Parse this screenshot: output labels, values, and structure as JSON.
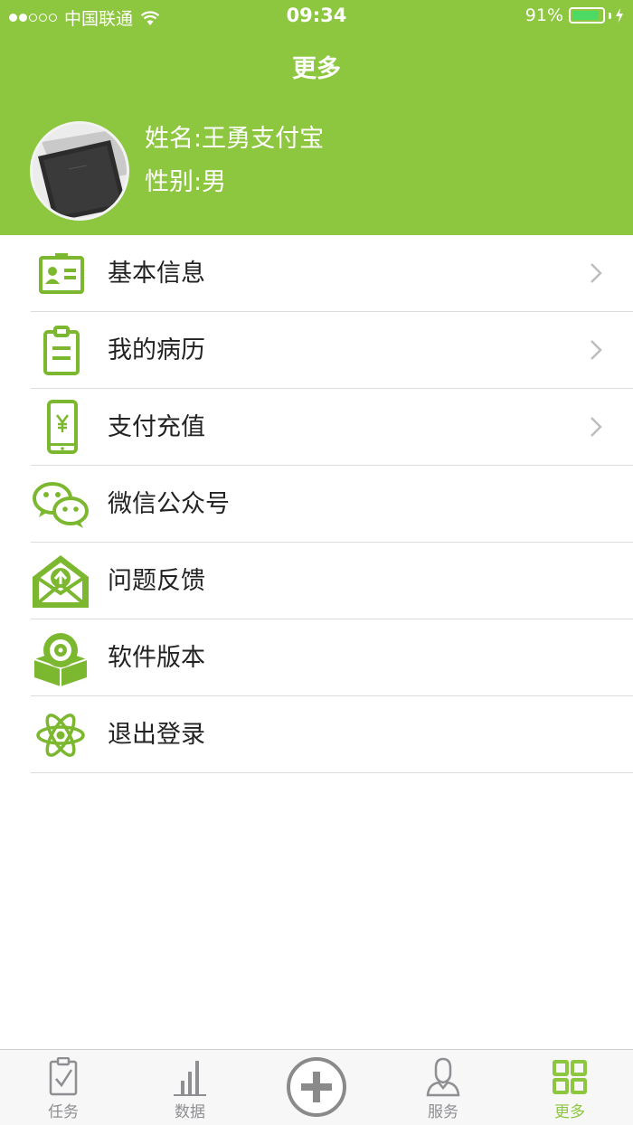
{
  "status_bar": {
    "carrier": "中国联通",
    "time": "09:34",
    "battery_percent": "91%",
    "battery_level": 0.91
  },
  "nav": {
    "title": "更多"
  },
  "profile": {
    "name_line": "姓名:王勇支付宝",
    "gender_line": "性别:男"
  },
  "menu": {
    "items": [
      {
        "label": "基本信息",
        "icon": "id-card-icon",
        "has_chevron": true
      },
      {
        "label": "我的病历",
        "icon": "clipboard-icon",
        "has_chevron": true
      },
      {
        "label": "支付充值",
        "icon": "phone-yuan-icon",
        "has_chevron": true
      },
      {
        "label": "微信公众号",
        "icon": "wechat-icon",
        "has_chevron": false
      },
      {
        "label": "问题反馈",
        "icon": "mail-upload-icon",
        "has_chevron": false
      },
      {
        "label": "软件版本",
        "icon": "software-box-icon",
        "has_chevron": false
      },
      {
        "label": "退出登录",
        "icon": "atom-icon",
        "has_chevron": false
      }
    ]
  },
  "tabbar": {
    "tabs": [
      {
        "label": "任务",
        "icon": "task-clipboard-icon"
      },
      {
        "label": "数据",
        "icon": "bar-chart-icon"
      },
      {
        "label": "",
        "icon": "add-circle-icon"
      },
      {
        "label": "服务",
        "icon": "person-icon"
      },
      {
        "label": "更多",
        "icon": "grid-icon"
      }
    ],
    "active": "更多"
  },
  "colors": {
    "brand_green": "#8dc63f",
    "icon_green": "#7cb82f",
    "text": "#222222",
    "tab_inactive": "#8e8e93"
  }
}
